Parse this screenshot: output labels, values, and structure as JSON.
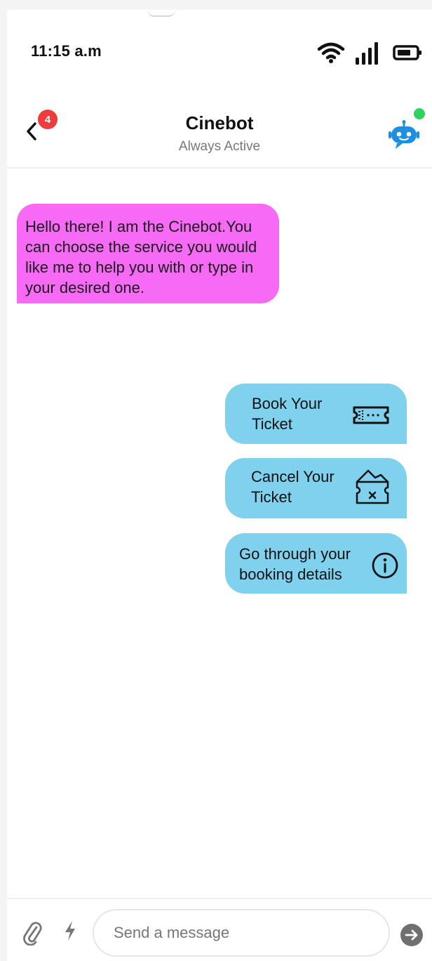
{
  "status_bar": {
    "time": "11:15 a.m"
  },
  "header": {
    "badge_count": "4",
    "title": "Cinebot",
    "subtitle": "Always Active"
  },
  "messages": {
    "bot_greeting": "Hello there! I am the Cinebot.You can choose the service you would like me to help you with or type in your desired one."
  },
  "options": [
    {
      "label": "Book Your Ticket",
      "icon": "ticket-icon"
    },
    {
      "label": "Cancel Your Ticket",
      "icon": "cancel-ticket-icon"
    },
    {
      "label": "Go through your booking details",
      "icon": "info-icon"
    }
  ],
  "input_bar": {
    "placeholder": "Send a message"
  },
  "colors": {
    "bot_bubble": "#f76af5",
    "option_bubble": "#7fd1ee",
    "badge": "#ef3b3b",
    "online": "#2fd35a",
    "bot_avatar": "#1e8fe0"
  }
}
